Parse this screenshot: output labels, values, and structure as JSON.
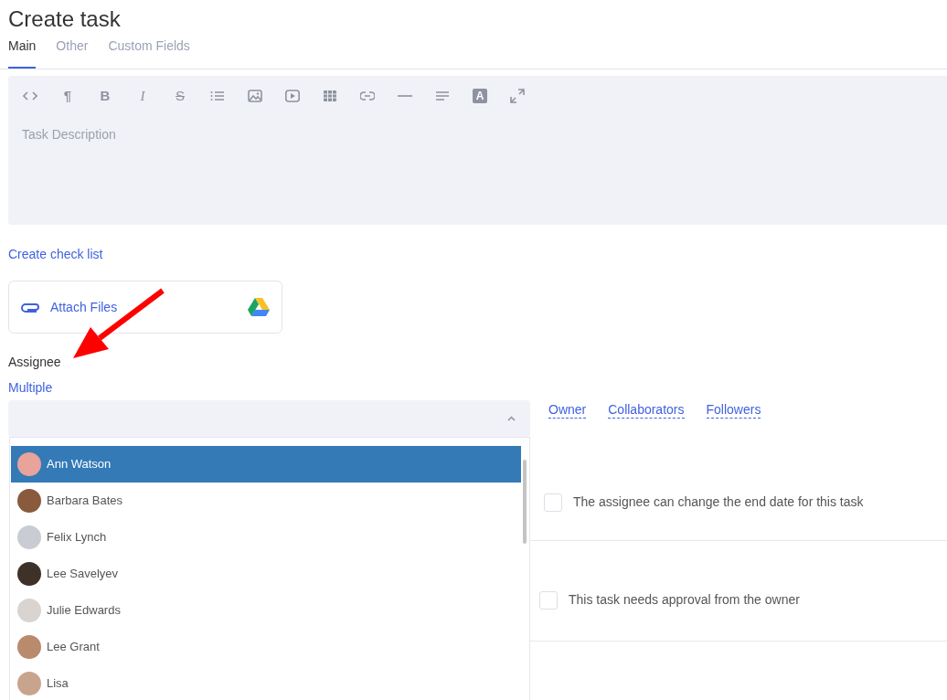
{
  "title": "Create task",
  "tabs": [
    {
      "label": "Main",
      "selected": true
    },
    {
      "label": "Other",
      "selected": false
    },
    {
      "label": "Custom Fields",
      "selected": false
    }
  ],
  "editor": {
    "toolbar": [
      {
        "kind": "code"
      },
      {
        "kind": "glyph",
        "label": "¶"
      },
      {
        "kind": "glyph",
        "label": "B"
      },
      {
        "kind": "italic",
        "label": "I"
      },
      {
        "kind": "strike",
        "label": "S"
      },
      {
        "kind": "list"
      },
      {
        "kind": "image"
      },
      {
        "kind": "video"
      },
      {
        "kind": "table"
      },
      {
        "kind": "link"
      },
      {
        "kind": "rule"
      },
      {
        "kind": "align"
      },
      {
        "kind": "badge",
        "label": "A"
      },
      {
        "kind": "expand"
      }
    ],
    "placeholder": "Task Description"
  },
  "checklist_link": "Create check list",
  "attach": {
    "label": "Attach Files"
  },
  "assignee": {
    "label": "Assignee",
    "mode_link": "Multiple",
    "options": [
      {
        "name": "Ann Watson",
        "selected": true,
        "color": "#e8a39a"
      },
      {
        "name": "Barbara Bates",
        "selected": false,
        "color": "#8a5a3c"
      },
      {
        "name": "Felix Lynch",
        "selected": false,
        "color": "#c9ccd2"
      },
      {
        "name": "Lee Savelyev",
        "selected": false,
        "color": "#3d3128"
      },
      {
        "name": "Julie Edwards",
        "selected": false,
        "color": "#d9d4d0"
      },
      {
        "name": "Lee Grant",
        "selected": false,
        "color": "#b98a6c"
      },
      {
        "name": "Lisa",
        "selected": false,
        "color": "#c9a48d"
      }
    ]
  },
  "roles": [
    "Owner",
    "Collaborators",
    "Followers"
  ],
  "options": [
    {
      "label": "The assignee can change the end date for this task",
      "checked": false
    },
    {
      "label": "This task needs approval from the owner",
      "checked": false
    }
  ]
}
